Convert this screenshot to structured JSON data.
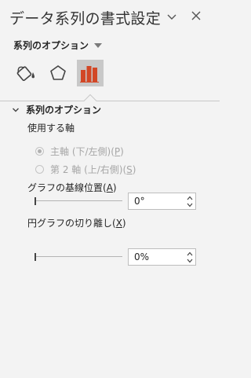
{
  "pane": {
    "title": "データ系列の書式設定"
  },
  "options_dropdown": {
    "label": "系列のオプション"
  },
  "section": {
    "title": "系列のオプション",
    "axis_group_label": "使用する軸",
    "primary_axis": {
      "before": "主軸 (下/左側)(",
      "key": "P",
      "after": ")",
      "selected": true
    },
    "secondary_axis": {
      "before": "第 2 軸 (上/右側)(",
      "key": "S",
      "after": ")",
      "selected": false
    },
    "gap_width": {
      "label_before": "グラフの基線位置(",
      "key": "A",
      "label_after": ")",
      "value": "0°"
    },
    "pie_explosion": {
      "label_before": "円グラフの切り離し(",
      "key": "X",
      "label_after": ")",
      "value": "0%"
    }
  },
  "colors": {
    "accent": "#d24726",
    "selected_tab_bg": "#c8c8c8",
    "pane_bg": "#f3f3f3",
    "disabled_text": "#a6a6a6"
  },
  "icons": {
    "menu": "chevron-down-icon",
    "close": "close-icon",
    "fill_line": "paint-bucket-icon",
    "effects": "pentagon-icon",
    "series_options": "bar-chart-icon",
    "section_toggle": "chevron-down-icon"
  }
}
